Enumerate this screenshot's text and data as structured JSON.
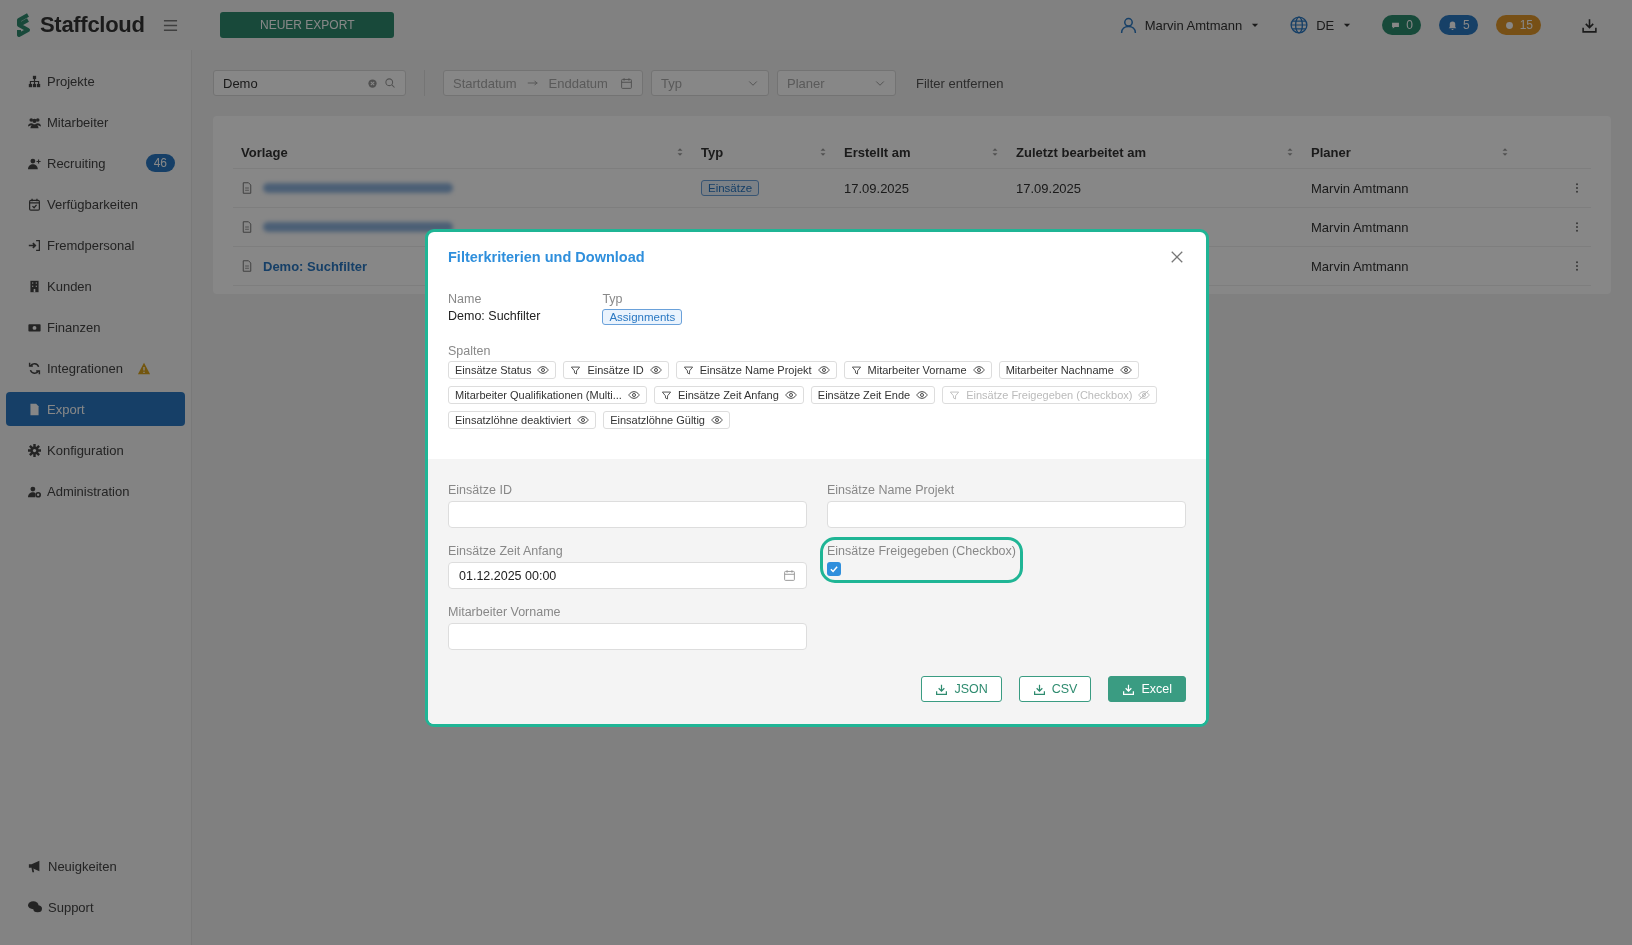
{
  "topbar": {
    "logo": "Staffcloud",
    "new_export": "NEUER EXPORT",
    "user": "Marvin Amtmann",
    "language": "DE",
    "counters": [
      {
        "value": "0",
        "color": "#184a3b"
      },
      {
        "value": "5",
        "color": "#164067"
      },
      {
        "value": "15",
        "color": "#775017"
      }
    ]
  },
  "sidebar": {
    "items": [
      {
        "label": "Projekte",
        "selected": false
      },
      {
        "label": "Mitarbeiter",
        "selected": false
      },
      {
        "label": "Recruiting",
        "selected": false,
        "badge": "46"
      },
      {
        "label": "Verfügbarkeiten",
        "selected": false
      },
      {
        "label": "Fremdpersonal",
        "selected": false
      },
      {
        "label": "Kunden",
        "selected": false
      },
      {
        "label": "Finanzen",
        "selected": false
      },
      {
        "label": "Integrationen",
        "selected": false,
        "warning": true
      },
      {
        "label": "Export",
        "selected": true
      },
      {
        "label": "Konfiguration",
        "selected": false
      },
      {
        "label": "Administration",
        "selected": false
      }
    ],
    "footer_items": [
      {
        "label": "Neuigkeiten"
      },
      {
        "label": "Support"
      }
    ]
  },
  "filters": {
    "search": "Demo",
    "start_placeholder": "Startdatum",
    "end_placeholder": "Enddatum",
    "type_placeholder": "Typ",
    "planner_placeholder": "Planer",
    "clear": "Filter entfernen"
  },
  "table": {
    "columns": [
      "Vorlage",
      "Typ",
      "Erstellt am",
      "Zuletzt bearbeitet am",
      "Planer"
    ],
    "rows": [
      {
        "name_blurred": true,
        "type": "Einsätze",
        "created": "17.09.2025",
        "edited": "17.09.2025",
        "planner": "Marvin Amtmann"
      },
      {
        "name_blurred": true,
        "planner": "Marvin Amtmann"
      },
      {
        "name": "Demo: Suchfilter",
        "planner": "Marvin Amtmann"
      }
    ]
  },
  "dialog": {
    "title": "Filterkriterien und Download",
    "name_label": "Name",
    "name": "Demo: Suchfilter",
    "type_label": "Typ",
    "type": "Assignments",
    "columns_label": "Spalten",
    "chips": [
      {
        "label": "Einsätze Status",
        "filter": false,
        "visible": true
      },
      {
        "label": "Einsätze ID",
        "filter": true,
        "visible": true
      },
      {
        "label": "Einsätze Name Projekt",
        "filter": true,
        "visible": true
      },
      {
        "label": "Mitarbeiter Vorname",
        "filter": true,
        "visible": true
      },
      {
        "label": "Mitarbeiter Nachname",
        "filter": false,
        "visible": true
      },
      {
        "label": "Mitarbeiter Qualifikationen (Multi...",
        "filter": false,
        "visible": true
      },
      {
        "label": "Einsätze Zeit Anfang",
        "filter": true,
        "visible": true
      },
      {
        "label": "Einsätze Zeit Ende",
        "filter": false,
        "visible": true
      },
      {
        "label": "Einsätze Freigegeben (Checkbox)",
        "filter": true,
        "visible": false
      },
      {
        "label": "Einsatzlöhne deaktiviert",
        "filter": false,
        "visible": true
      },
      {
        "label": "Einsatzlöhne Gültig",
        "filter": false,
        "visible": true
      }
    ],
    "fields": [
      {
        "kind": "text",
        "label": "Einsätze ID",
        "highlighted": false
      },
      {
        "kind": "text",
        "label": "Einsätze Name Projekt",
        "highlighted": false
      },
      {
        "kind": "date",
        "label": "Einsätze Zeit Anfang",
        "value": "01.12.2025 00:00",
        "highlighted": false
      },
      {
        "kind": "checkbox",
        "label": "Einsätze Freigegeben (Checkbox)",
        "checked": true,
        "highlighted": true
      },
      {
        "kind": "text",
        "label": "Mitarbeiter Vorname",
        "highlighted": false
      }
    ],
    "buttons": [
      {
        "label": "JSON",
        "primary": false
      },
      {
        "label": "CSV",
        "primary": false
      },
      {
        "label": "Excel",
        "primary": true
      }
    ]
  }
}
